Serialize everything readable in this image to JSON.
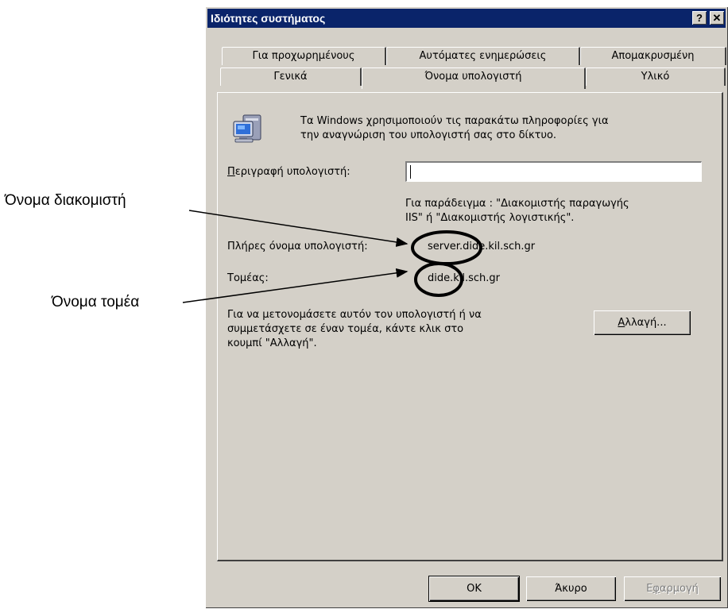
{
  "window": {
    "title": "Ιδιότητες συστήματος",
    "help_label": "?",
    "close_label": "✕"
  },
  "tabs": {
    "row_back": [
      "Για προχωρημένους",
      "Αυτόματες ενημερώσεις",
      "Απομακρυσμένη"
    ],
    "row_front": [
      "Γενικά",
      "Όνομα υπολογιστή",
      "Υλικό"
    ],
    "active": "Όνομα υπολογιστή"
  },
  "panel": {
    "intro_line1": "Τα Windows χρησιμοποιούν τις παρακάτω πληροφορίες για",
    "intro_line2": "την αναγνώριση του υπολογιστή σας στο δίκτυο.",
    "description_label": "Περιγραφή υπολογιστή:",
    "description_value": "",
    "example_line1": "Για παράδειγμα : \"Διακομιστής παραγωγής",
    "example_line2": "IIS\" ή \"Διακομιστής λογιστικής\".",
    "full_name_label": "Πλήρες όνομα υπολογιστή:",
    "full_name_value": "server.dide.kil.sch.gr",
    "domain_label": "Τομέας:",
    "domain_value": "dide.kil.sch.gr",
    "rename_line1": "Για να μετονομάσετε αυτόν τον υπολογιστή ή να",
    "rename_line2": "συμμετάσχετε σε έναν τομέα, κάντε κλικ στο",
    "rename_line3": "κουμπί \"Αλλαγή\".",
    "change_button": "Αλλαγή..."
  },
  "footer": {
    "ok": "OK",
    "cancel": "Άκυρο",
    "apply": "Εφαρμογή"
  },
  "annotations": {
    "server_name": "Όνομα διακομιστή",
    "domain_name": "Όνομα τομέα"
  },
  "icons": [
    "computer-icon"
  ],
  "colors": {
    "titlebar": "#0a246a",
    "dialog_face": "#d4d0c8",
    "highlight_circle": "#000000"
  }
}
